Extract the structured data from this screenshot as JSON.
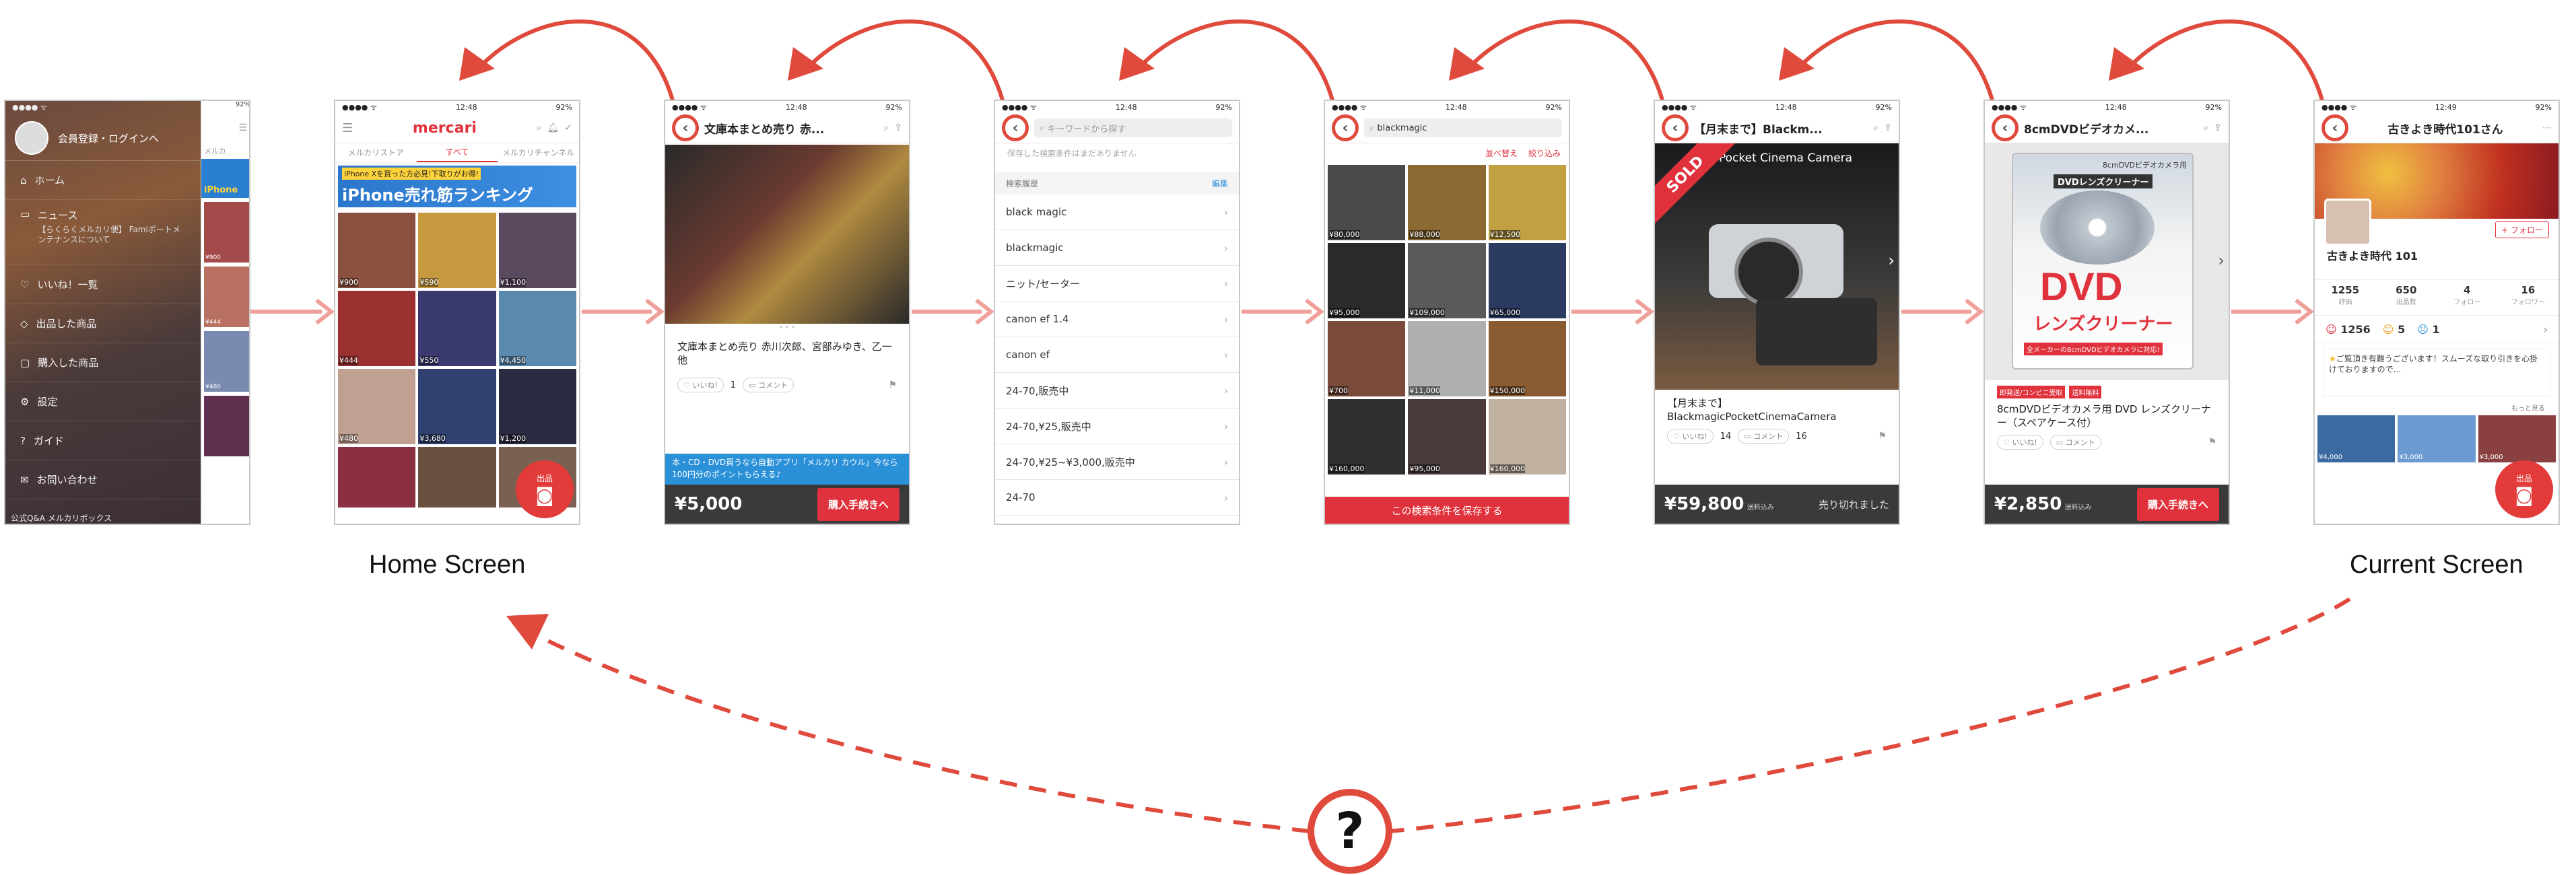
{
  "captions": {
    "home": "Home Screen",
    "current": "Current Screen"
  },
  "question_mark": "?",
  "status": {
    "t1248": "12:48",
    "t1249": "12:49",
    "battery": "92%"
  },
  "s1": {
    "account": "会員登録・ログインへ",
    "items": [
      "ホーム",
      "ニュース",
      "いいね！一覧",
      "出品した商品",
      "購入した商品",
      "設定",
      "ガイド",
      "お問い合わせ"
    ],
    "news_sub": "【らくらくメルカリ便】 Famiポートメンテナンスについて",
    "footer": "公式Q&A メルカリボックス",
    "peek_tab": "メルカ",
    "peek_banner": "iPhone",
    "peek_prices": [
      "¥900",
      "¥444",
      "¥480"
    ]
  },
  "s2": {
    "logo": "mercari",
    "tabs": [
      "メルカリストア",
      "すべて",
      "メルカリチャンネル"
    ],
    "banner_top": "iPhone Xを買った方必見!下取りがお得!",
    "banner_main": "iPhone売れ筋ランキング",
    "prices": [
      "¥900",
      "¥590",
      "¥1,100",
      "¥444",
      "¥550",
      "¥4,450",
      "¥480",
      "¥3,680",
      "¥1,200"
    ],
    "fab": "出品"
  },
  "s3": {
    "title": "文庫本まとめ売り 赤...",
    "item_title": "文庫本まとめ売り 赤川次郎、宮部みゆき、乙一他",
    "like": "いいね!",
    "like_count": "1",
    "comment": "コメント",
    "banner": "本・CD・DVD買うなら自動アプリ「メルカリ カウル」今なら100円分のポイントもらえる♪",
    "price": "¥5,000",
    "buy": "購入手続きへ"
  },
  "s4": {
    "placeholder": "キーワードから探す",
    "saved_note": "保存した検索条件はまだありません",
    "history_header": "検索履歴",
    "edit": "編集",
    "history": [
      "black magic",
      "blackmagic",
      "ニット/セーター",
      "canon ef 1.4",
      "canon ef",
      "24-70,販売中",
      "24-70,¥25,販売中",
      "24-70,¥25~¥3,000,販売中",
      "24-70"
    ]
  },
  "s5": {
    "query": "blackmagic",
    "sort": "並べ替え",
    "filter": "絞り込み",
    "prices": [
      "¥80,000",
      "¥88,000",
      "¥12,500",
      "¥95,000",
      "¥109,000",
      "¥65,000",
      "¥700",
      "¥11,000",
      "¥150,000",
      "¥160,000",
      "¥95,000",
      "¥160,000"
    ],
    "save": "この検索条件を保存する"
  },
  "s6": {
    "title": "【月末まで】Blackm...",
    "sold": "SOLD",
    "camera_text": "Pocket Cinema Camera",
    "item_title": "【月末まで】BlackmagicPocketCinemaCamera",
    "like": "いいね!",
    "like_count": "14",
    "comment": "コメント",
    "comment_count": "16",
    "price": "¥59,800",
    "tax": "送料込み",
    "sold_out": "売り切れました"
  },
  "s7": {
    "title": "8cmDVDビデオカメ...",
    "pkg_top": "8cmDVDビデオカメラ用",
    "pkg_sub": "DVDレンズクリーナー",
    "pkg_big": "DVD",
    "pkg_red": "レンズクリーナー",
    "pkg_bottom": "全メーカーの8cmDVDビデオカメラに対応!",
    "badge1": "即発送/コンビニ受取",
    "badge2": "送料無料",
    "item_title": "8cmDVDビデオカメラ用 DVD レンズクリーナー（スペアケース付）",
    "like": "いいね!",
    "comment": "コメント",
    "price": "¥2,850",
    "tax": "送料込み",
    "buy": "購入手続きへ"
  },
  "s8": {
    "title": "古きよき時代101さん",
    "follow": "+ フォロー",
    "name": "古きよき時代 101",
    "stats": [
      {
        "value": "1255",
        "label": "評価"
      },
      {
        "value": "650",
        "label": "出品数"
      },
      {
        "value": "4",
        "label": "フォロー"
      },
      {
        "value": "16",
        "label": "フォロワー"
      }
    ],
    "ratings": [
      "1256",
      "5",
      "1"
    ],
    "msg": "ご覧頂き有難うございます！スムーズな取り引きを心掛けておりますので...",
    "more": "もっと見る",
    "prices": [
      "¥4,000",
      "¥3,000",
      "¥3,000"
    ],
    "fab": "出品"
  },
  "colors": {
    "accent": "#e04a3c",
    "arrow": "#f0a09a",
    "brand": "#e0323d"
  }
}
